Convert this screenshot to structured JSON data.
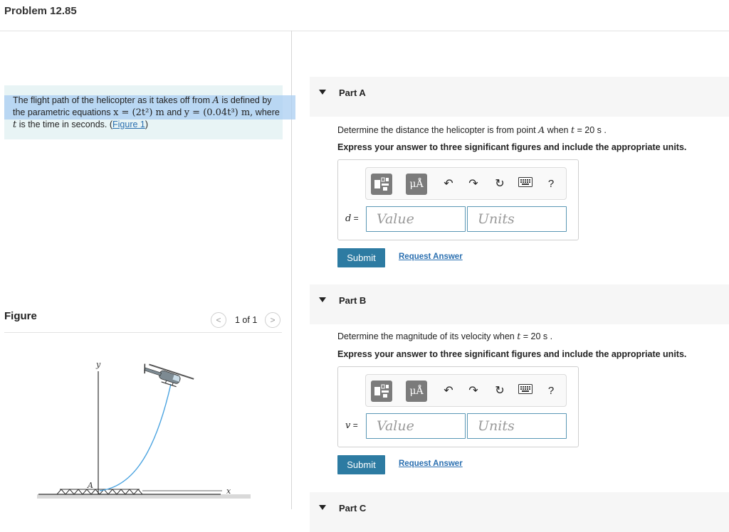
{
  "page": {
    "title": "Problem 12.85"
  },
  "statement": {
    "text1": "The flight path of the helicopter as it takes off from ",
    "pointA": "A",
    "text2": " is defined by the parametric equations ",
    "eq_x": "x = (2t²) m",
    "and": " and ",
    "eq_y": "y = (0.04t³) m,",
    "text3": " where ",
    "t": "t",
    "text4": " is the time in seconds. (",
    "figure_link": "Figure 1",
    "text5": ")"
  },
  "figure": {
    "heading": "Figure",
    "pager": "1 of 1",
    "prev_glyph": "<",
    "next_glyph": ">",
    "axis_y": "y",
    "axis_x": "x",
    "point_label": "A"
  },
  "toolbar": {
    "units_glyph": "μÅ",
    "undo_glyph": "↶",
    "redo_glyph": "↷",
    "reset_glyph": "↻",
    "help_glyph": "?"
  },
  "parts": [
    {
      "label": "Part A",
      "question_pre": "Determine the distance the helicopter is from point ",
      "question_var": "A",
      "question_mid": " when ",
      "question_t": "t",
      "question_post": " = 20  s .",
      "instruction": "Express your answer to three significant figures and include the appropriate units.",
      "variable": "d",
      "value_placeholder": "Value",
      "units_placeholder": "Units",
      "submit_label": "Submit",
      "request_label": "Request Answer"
    },
    {
      "label": "Part B",
      "question_pre": "Determine the magnitude of its velocity when ",
      "question_t": "t",
      "question_post": " = 20  s .",
      "instruction": "Express your answer to three significant figures and include the appropriate units.",
      "variable": "v",
      "value_placeholder": "Value",
      "units_placeholder": "Units",
      "submit_label": "Submit",
      "request_label": "Request Answer"
    },
    {
      "label": "Part C"
    }
  ]
}
